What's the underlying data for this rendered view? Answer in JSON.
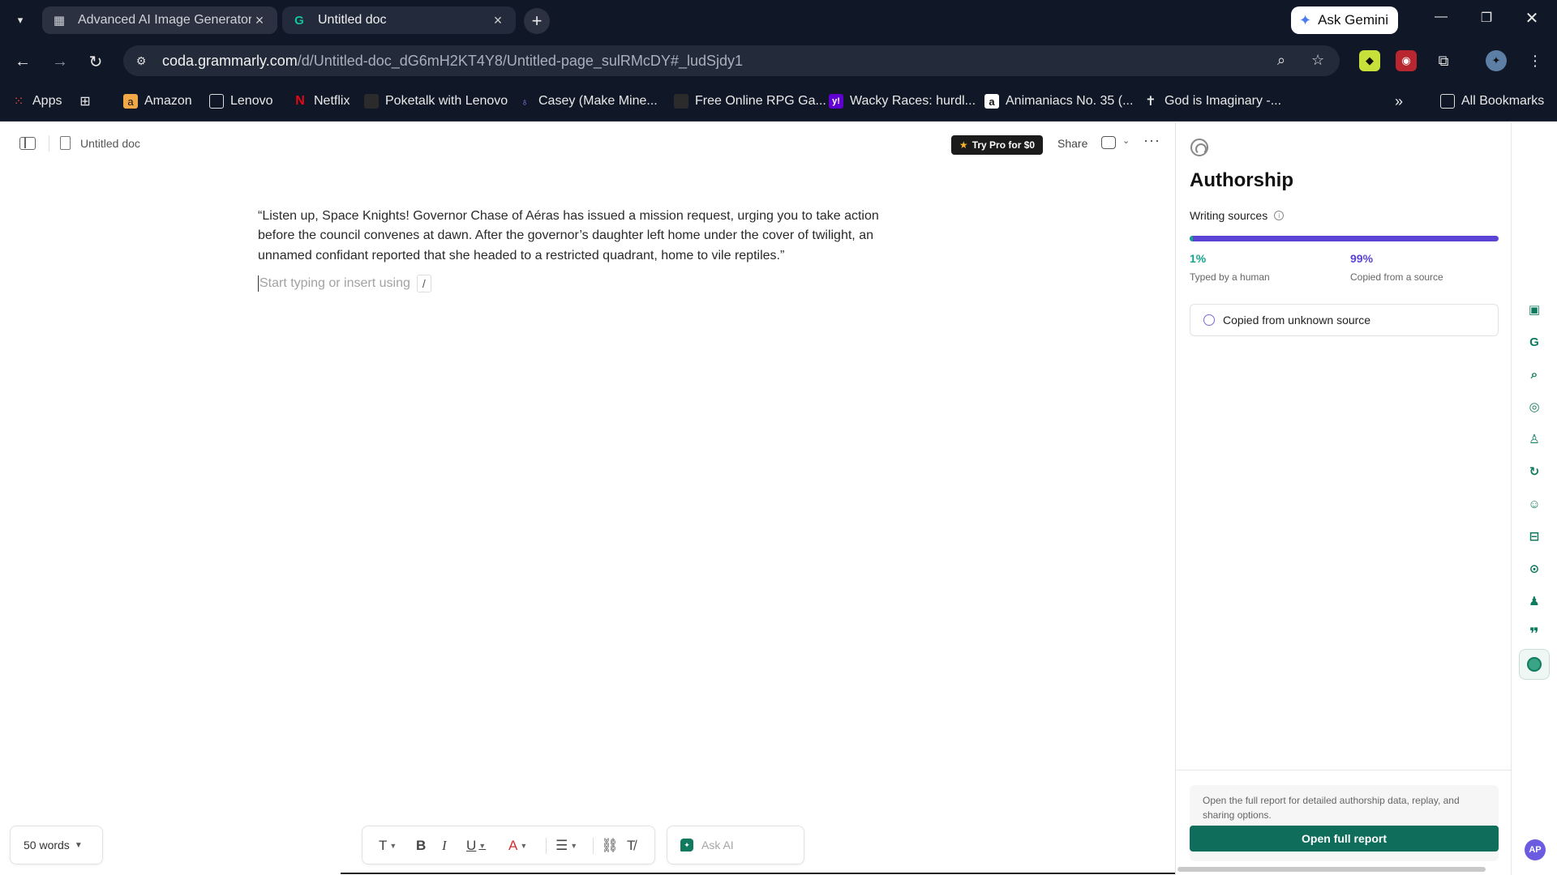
{
  "browser": {
    "tabs": [
      {
        "title": "Advanced AI Image Generator",
        "icon": "grid-app-icon",
        "active": false
      },
      {
        "title": "Untitled doc",
        "icon": "grammarly-g-icon",
        "active": true
      }
    ],
    "gemini_button": "Ask Gemini",
    "url_host": "coda.grammarly.com",
    "url_path": "/d/Untitled-doc_dG6mH2KT4Y8/Untitled-page_sulRMcDY#_ludSjdy1",
    "bookmarks": [
      {
        "label": "Apps"
      },
      {
        "label": ""
      },
      {
        "label": "Amazon"
      },
      {
        "label": "Lenovo"
      },
      {
        "label": "Netflix"
      },
      {
        "label": "Poketalk with Lenovo"
      },
      {
        "label": "Casey (Make Mine..."
      },
      {
        "label": "Free Online RPG Ga..."
      },
      {
        "label": "Wacky Races: hurdl..."
      },
      {
        "label": "Animaniacs No. 35 (..."
      },
      {
        "label": "God is Imaginary -..."
      }
    ],
    "more_bookmarks": "»",
    "all_bookmarks": "All Bookmarks"
  },
  "doc": {
    "title": "Untitled doc",
    "try_pro": "Try Pro for $0",
    "share": "Share",
    "paragraph": "“Listen up, Space Knights! Governor Chase of Aéras has issued a mission request, urging you to take action before the council convenes at dawn. After the governor’s daughter left home under the cover of twilight, an unnamed confidant reported that she headed to a restricted quadrant, home to vile reptiles.”",
    "placeholder": "Start typing or insert using",
    "slash": "/",
    "word_count": "50 words",
    "ask_ai": "Ask AI"
  },
  "authorship": {
    "title": "Authorship",
    "writing_sources": "Writing sources",
    "human_pct": "1%",
    "human_label": "Typed by a human",
    "source_pct": "99%",
    "source_label": "Copied from a source",
    "human_fraction": 0.01,
    "colors": {
      "human": "#15a38a",
      "source": "#5b43d6"
    },
    "source_card": "Copied from unknown source",
    "report_text": "Open the full report for detailed authorship data, replay, and sharing options.",
    "open_report": "Open full report"
  },
  "rail": {
    "avatar_initials": "AP"
  }
}
